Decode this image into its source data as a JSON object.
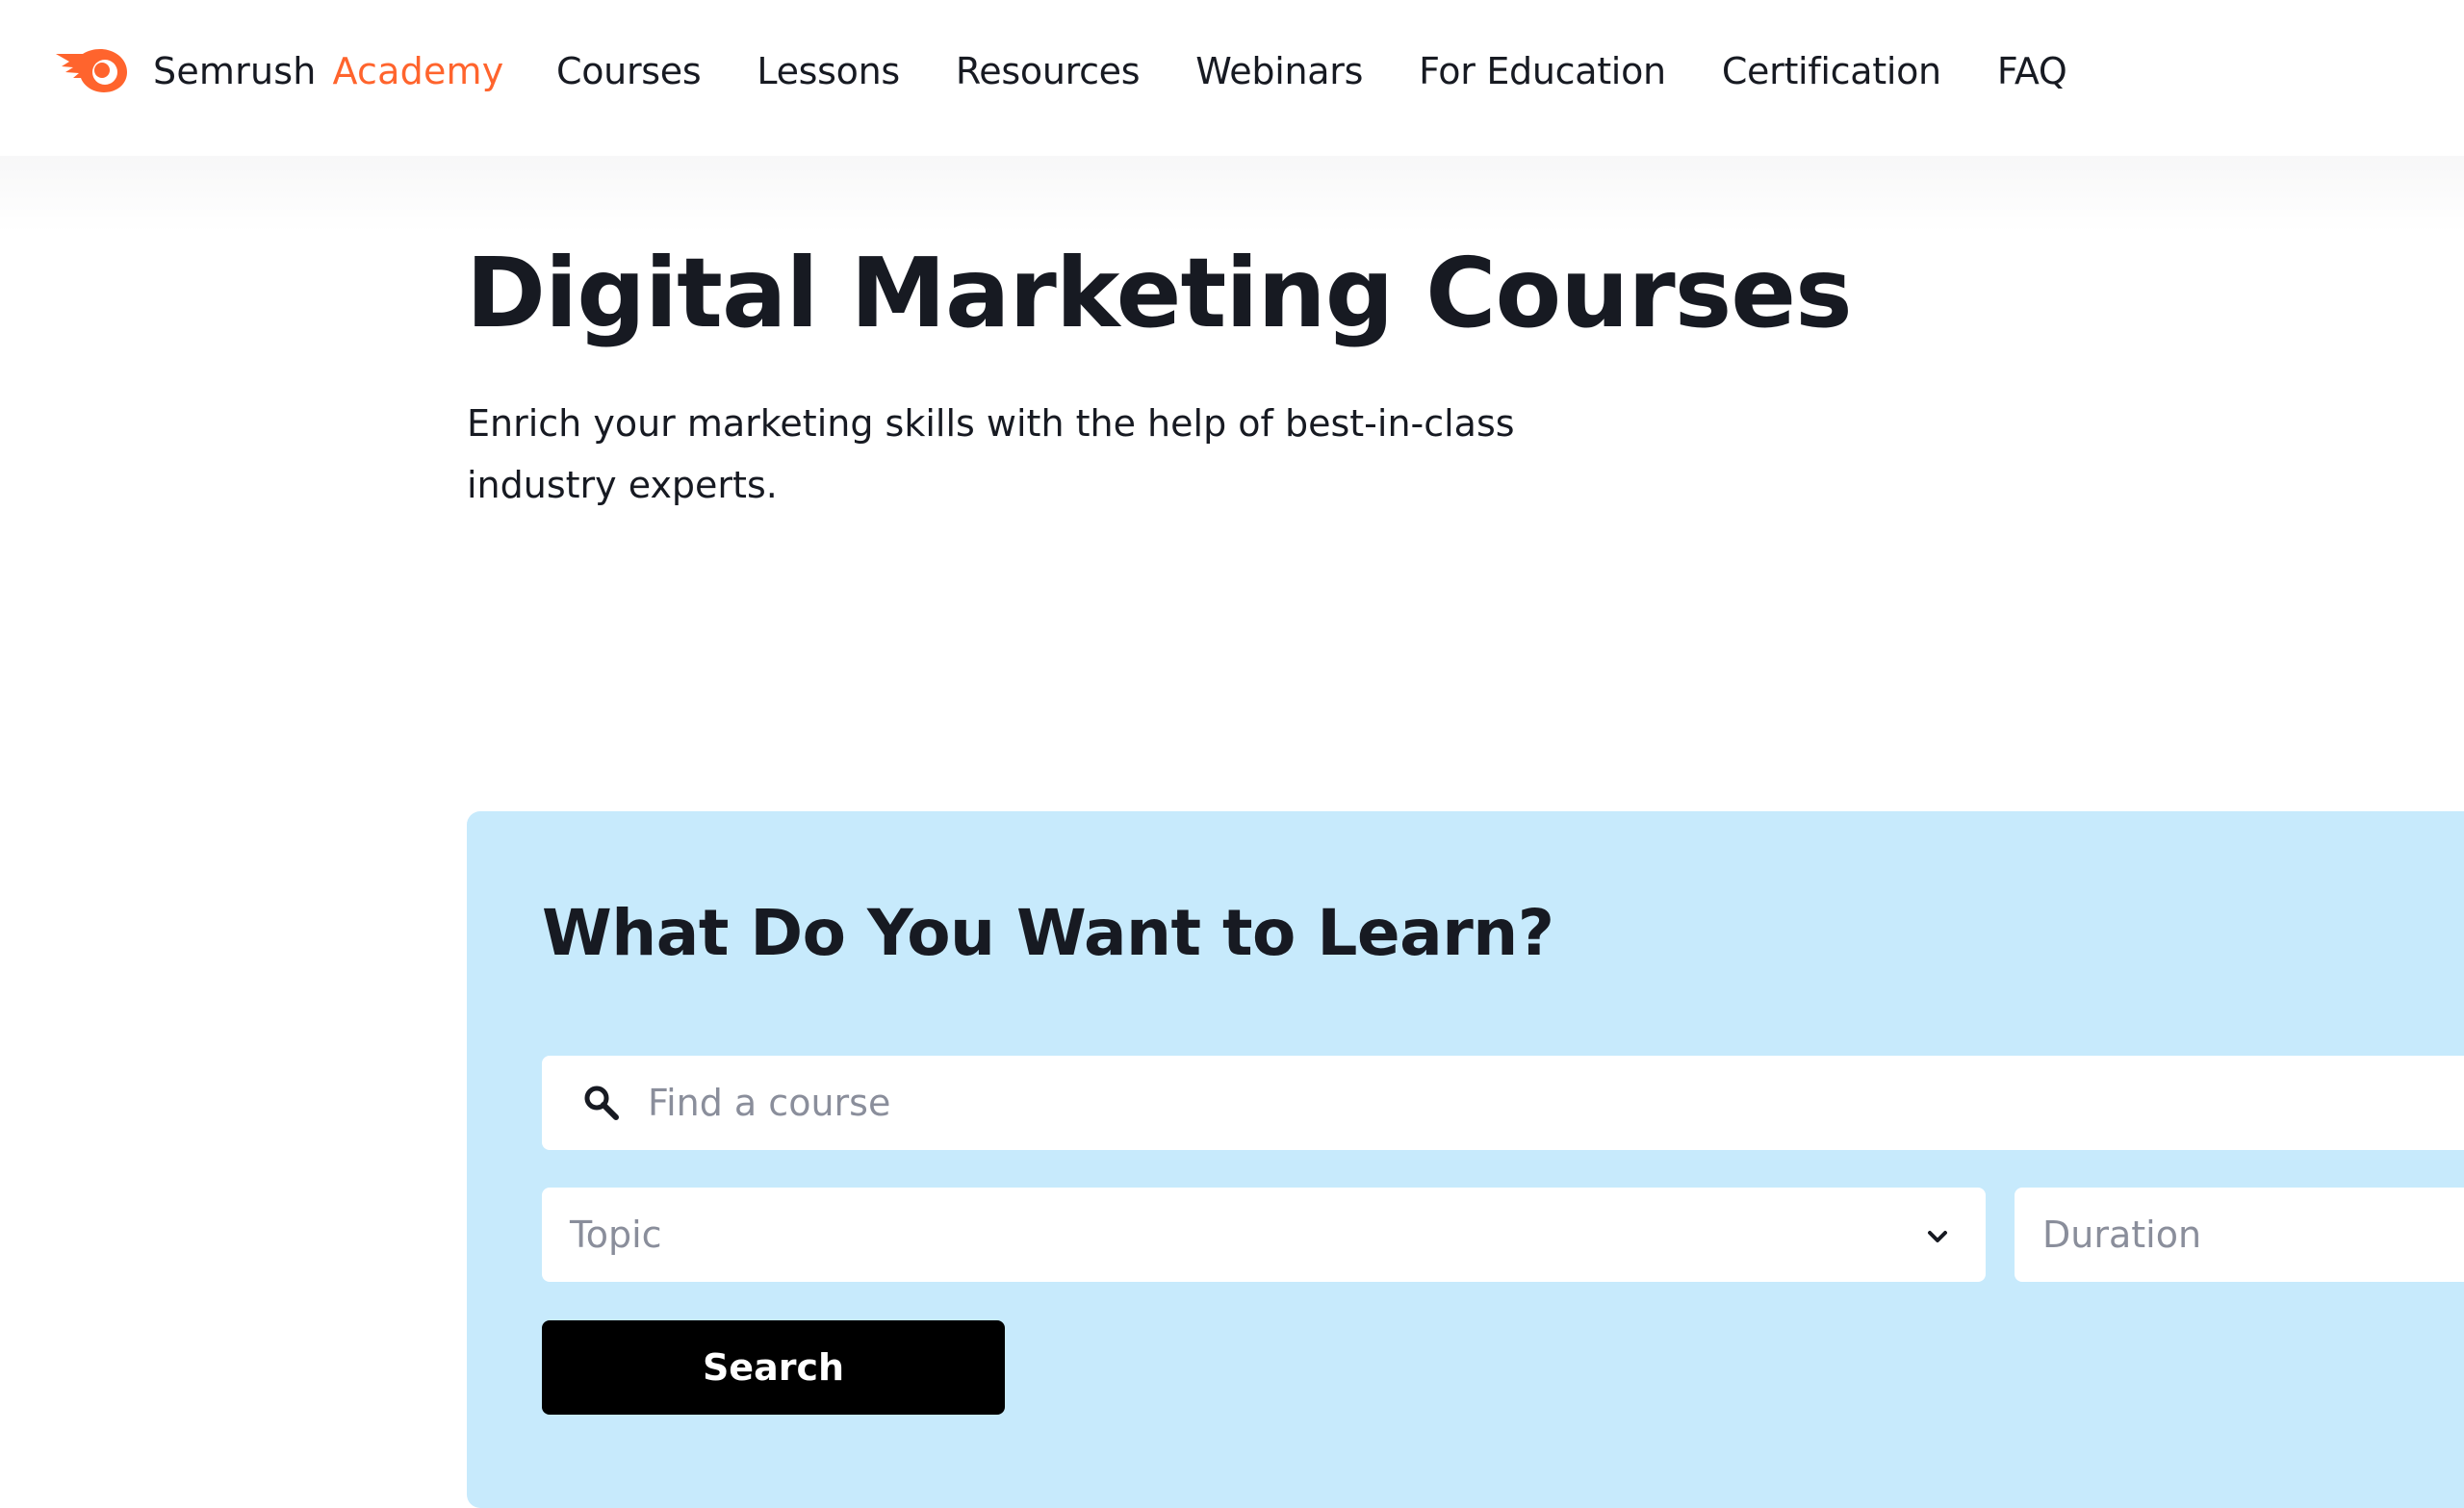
{
  "header": {
    "brand_name": "Semrush",
    "brand_sub": "Academy",
    "logo_icon": "semrush-fireball-logo",
    "nav": [
      {
        "label": "Courses"
      },
      {
        "label": "Lessons"
      },
      {
        "label": "Resources"
      },
      {
        "label": "Webinars"
      },
      {
        "label": "For Education"
      },
      {
        "label": "Certification"
      },
      {
        "label": "FAQ"
      }
    ]
  },
  "hero": {
    "title": "Digital Marketing Courses",
    "subtitle": "Enrich your marketing skills with the help of best-in-class industry experts."
  },
  "search_panel": {
    "title": "What Do You Want to Learn?",
    "search": {
      "value": "",
      "placeholder": "Find a course",
      "icon": "search-icon"
    },
    "topic": {
      "label": "Topic",
      "icon": "chevron-down-icon"
    },
    "duration": {
      "label": "Duration"
    },
    "button_label": "Search"
  },
  "colors": {
    "accent": "#ff642d",
    "panel_background": "#c7eafc",
    "text": "#171a22",
    "placeholder": "#8a8e9b",
    "button": "#000000"
  }
}
